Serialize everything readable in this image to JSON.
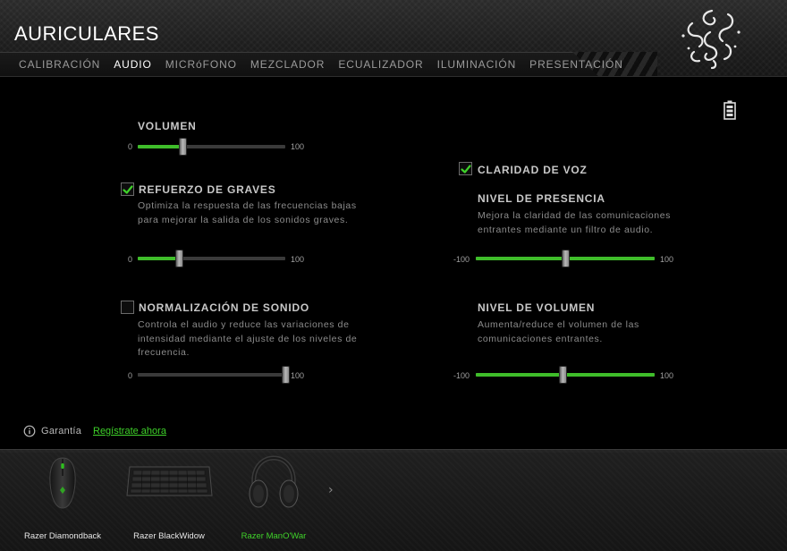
{
  "app": {
    "title": "AURICULARES"
  },
  "tabs": [
    {
      "label": "CALIBRACIÓN",
      "active": false
    },
    {
      "label": "AUDIO",
      "active": true
    },
    {
      "label": "MICRóFONO",
      "active": false
    },
    {
      "label": "MEZCLADOR",
      "active": false
    },
    {
      "label": "ECUALIZADOR",
      "active": false
    },
    {
      "label": "ILUMINACIÓN",
      "active": false
    },
    {
      "label": "PRESENTACIÓN",
      "active": false
    }
  ],
  "icons": {
    "logo": "razer-snake-logo",
    "battery": "battery-icon",
    "info": "info-icon",
    "check": "check-icon",
    "next": "chevron-right-icon"
  },
  "colors": {
    "accent": "#3fbd2a",
    "link": "#3fd22a",
    "background": "#000000"
  },
  "left": {
    "volume": {
      "label": "VOLUMEN",
      "min": "0",
      "max": "100",
      "value": 30
    },
    "bass": {
      "label": "REFUERZO DE GRAVES",
      "checked": true,
      "description": "Optimiza la respuesta de las frecuencias bajas para mejorar la salida de los sonidos graves.",
      "min": "0",
      "max": "100",
      "value": 28
    },
    "normalization": {
      "label": "NORMALIZACIÓN DE SONIDO",
      "checked": false,
      "description": "Controla el audio y reduce las variaciones de intensidad mediante el ajuste de los niveles de frecuencia.",
      "min": "0",
      "max": "100",
      "value": 100
    }
  },
  "right": {
    "voice_clarity": {
      "label": "CLARIDAD DE VOZ",
      "checked": true
    },
    "presence": {
      "label": "NIVEL DE PRESENCIA",
      "description": "Mejora la claridad de las comunicaciones entrantes mediante un filtro de audio.",
      "min": "-100",
      "max": "100",
      "value": 0
    },
    "volume_level": {
      "label": "NIVEL DE VOLUMEN",
      "description": "Aumenta/reduce el volumen de las comunicaciones entrantes.",
      "min": "-100",
      "max": "100",
      "value": -3
    }
  },
  "warranty": {
    "label": "Garantía",
    "link": "Regístrate ahora"
  },
  "devices": [
    {
      "name": "Razer Diamondback",
      "active": false
    },
    {
      "name": "Razer BlackWidow",
      "active": false
    },
    {
      "name": "Razer ManO'War",
      "active": true
    }
  ]
}
